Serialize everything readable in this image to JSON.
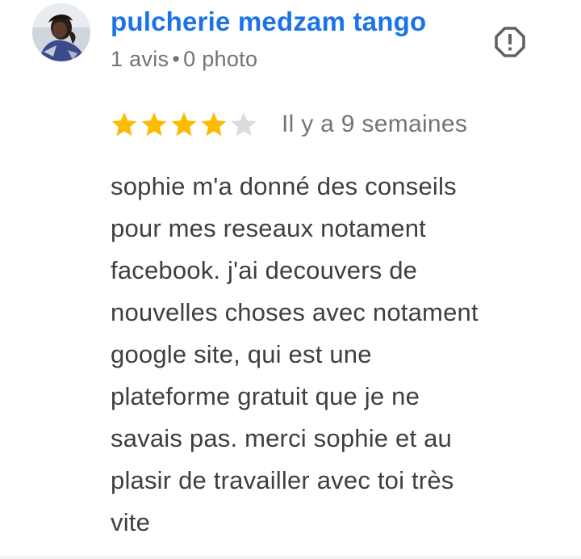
{
  "review": {
    "reviewer_name": "pulcherie medzam tango",
    "review_count": "1 avis",
    "separator": "•",
    "photo_count": "0 photo",
    "rating": 4,
    "rating_max": 5,
    "date": "Il y a 9 semaines",
    "text_lines": [
      "sophie m'a donné des conseils",
      "pour mes reseaux notament",
      "facebook. j'ai decouvers de",
      "nouvelles choses avec notament",
      "google site, qui est une",
      "plateforme gratuit que je ne",
      "savais pas. merci sophie et au",
      "plasir de travailler avec toi très",
      "vite"
    ]
  },
  "icons": {
    "report": "report-flag-icon",
    "star_filled": "star-filled-icon",
    "star_empty": "star-empty-icon"
  },
  "colors": {
    "name": "#1a73e8",
    "meta": "#70757a",
    "body_text": "#3c4043",
    "star_filled": "#fbbc04",
    "star_empty": "#dadce0",
    "report_icon": "#5f6368"
  }
}
